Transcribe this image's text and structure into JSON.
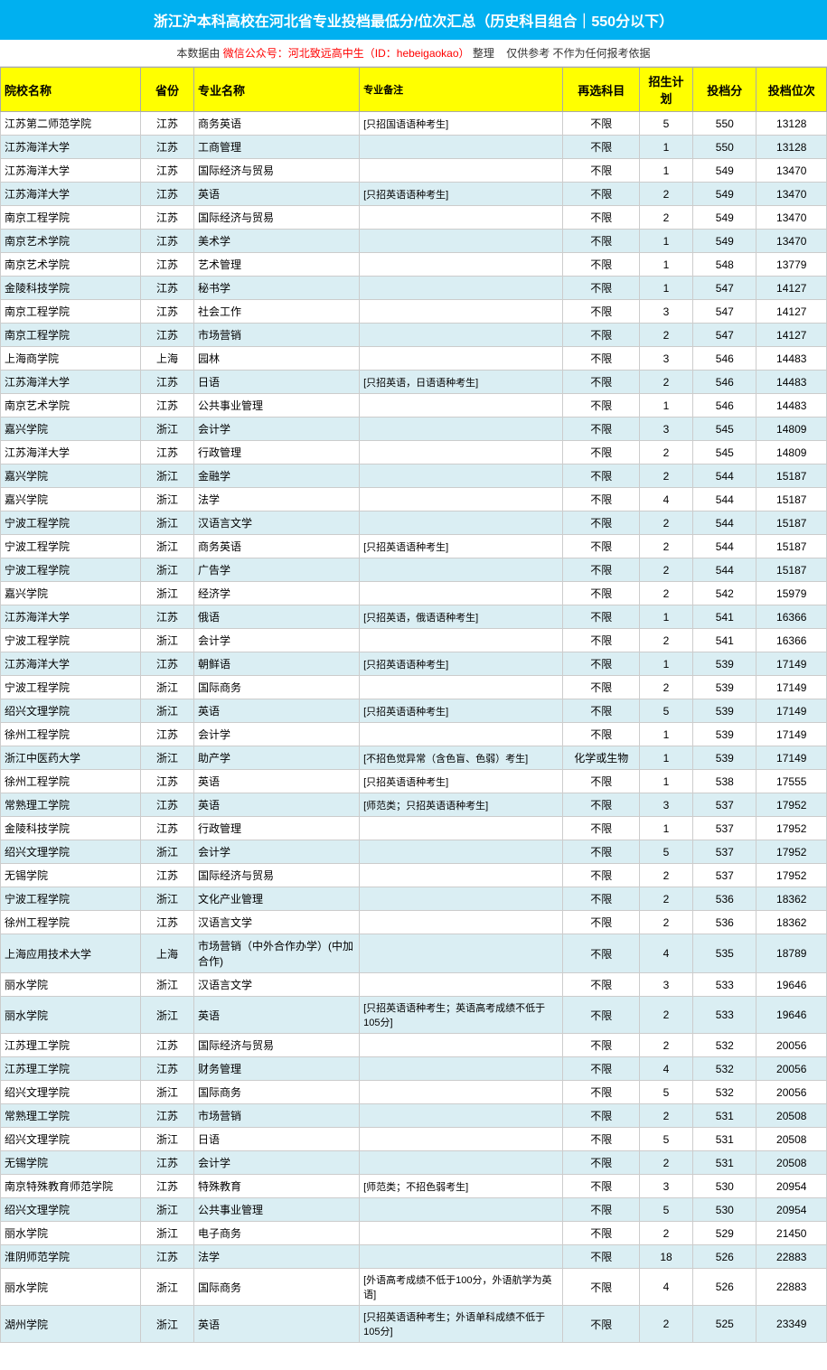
{
  "title": "浙江沪本科高校在河北省专业投档最低分/位次汇总（历史科目组合｜550分以下）",
  "subtitle": {
    "prefix": "本数据由",
    "link": "微信公众号：河北致远高中生（ID：hebeigaokao）",
    "suffix": "整理",
    "note": "仅供参考  不作为任何报考依据"
  },
  "headers": [
    "院校名称",
    "省份",
    "专业名称",
    "专业备注",
    "再选科目",
    "招生计划",
    "投档分",
    "投档位次"
  ],
  "rows": [
    [
      "江苏第二师范学院",
      "江苏",
      "商务英语",
      "[只招国语语种考生]",
      "不限",
      "5",
      "550",
      "13128"
    ],
    [
      "江苏海洋大学",
      "江苏",
      "工商管理",
      "",
      "不限",
      "1",
      "550",
      "13128"
    ],
    [
      "江苏海洋大学",
      "江苏",
      "国际经济与贸易",
      "",
      "不限",
      "1",
      "549",
      "13470"
    ],
    [
      "江苏海洋大学",
      "江苏",
      "英语",
      "[只招英语语种考生]",
      "不限",
      "2",
      "549",
      "13470"
    ],
    [
      "南京工程学院",
      "江苏",
      "国际经济与贸易",
      "",
      "不限",
      "2",
      "549",
      "13470"
    ],
    [
      "南京艺术学院",
      "江苏",
      "美术学",
      "",
      "不限",
      "1",
      "549",
      "13470"
    ],
    [
      "南京艺术学院",
      "江苏",
      "艺术管理",
      "",
      "不限",
      "1",
      "548",
      "13779"
    ],
    [
      "金陵科技学院",
      "江苏",
      "秘书学",
      "",
      "不限",
      "1",
      "547",
      "14127"
    ],
    [
      "南京工程学院",
      "江苏",
      "社会工作",
      "",
      "不限",
      "3",
      "547",
      "14127"
    ],
    [
      "南京工程学院",
      "江苏",
      "市场营销",
      "",
      "不限",
      "2",
      "547",
      "14127"
    ],
    [
      "上海商学院",
      "上海",
      "园林",
      "",
      "不限",
      "3",
      "546",
      "14483"
    ],
    [
      "江苏海洋大学",
      "江苏",
      "日语",
      "[只招英语，日语语种考生]",
      "不限",
      "2",
      "546",
      "14483"
    ],
    [
      "南京艺术学院",
      "江苏",
      "公共事业管理",
      "",
      "不限",
      "1",
      "546",
      "14483"
    ],
    [
      "嘉兴学院",
      "浙江",
      "会计学",
      "",
      "不限",
      "3",
      "545",
      "14809"
    ],
    [
      "江苏海洋大学",
      "江苏",
      "行政管理",
      "",
      "不限",
      "2",
      "545",
      "14809"
    ],
    [
      "嘉兴学院",
      "浙江",
      "金融学",
      "",
      "不限",
      "2",
      "544",
      "15187"
    ],
    [
      "嘉兴学院",
      "浙江",
      "法学",
      "",
      "不限",
      "4",
      "544",
      "15187"
    ],
    [
      "宁波工程学院",
      "浙江",
      "汉语言文学",
      "",
      "不限",
      "2",
      "544",
      "15187"
    ],
    [
      "宁波工程学院",
      "浙江",
      "商务英语",
      "[只招英语语种考生]",
      "不限",
      "2",
      "544",
      "15187"
    ],
    [
      "宁波工程学院",
      "浙江",
      "广告学",
      "",
      "不限",
      "2",
      "544",
      "15187"
    ],
    [
      "嘉兴学院",
      "浙江",
      "经济学",
      "",
      "不限",
      "2",
      "542",
      "15979"
    ],
    [
      "江苏海洋大学",
      "江苏",
      "俄语",
      "[只招英语，俄语语种考生]",
      "不限",
      "1",
      "541",
      "16366"
    ],
    [
      "宁波工程学院",
      "浙江",
      "会计学",
      "",
      "不限",
      "2",
      "541",
      "16366"
    ],
    [
      "江苏海洋大学",
      "江苏",
      "朝鲜语",
      "[只招英语语种考生]",
      "不限",
      "1",
      "539",
      "17149"
    ],
    [
      "宁波工程学院",
      "浙江",
      "国际商务",
      "",
      "不限",
      "2",
      "539",
      "17149"
    ],
    [
      "绍兴文理学院",
      "浙江",
      "英语",
      "[只招英语语种考生]",
      "不限",
      "5",
      "539",
      "17149"
    ],
    [
      "徐州工程学院",
      "江苏",
      "会计学",
      "",
      "不限",
      "1",
      "539",
      "17149"
    ],
    [
      "浙江中医药大学",
      "浙江",
      "助产学",
      "[不招色觉异常（含色盲、色弱）考生]",
      "化学或生物",
      "1",
      "539",
      "17149"
    ],
    [
      "徐州工程学院",
      "江苏",
      "英语",
      "[只招英语语种考生]",
      "不限",
      "1",
      "538",
      "17555"
    ],
    [
      "常熟理工学院",
      "江苏",
      "英语",
      "[师范类；只招英语语种考生]",
      "不限",
      "3",
      "537",
      "17952"
    ],
    [
      "金陵科技学院",
      "江苏",
      "行政管理",
      "",
      "不限",
      "1",
      "537",
      "17952"
    ],
    [
      "绍兴文理学院",
      "浙江",
      "会计学",
      "",
      "不限",
      "5",
      "537",
      "17952"
    ],
    [
      "无锡学院",
      "江苏",
      "国际经济与贸易",
      "",
      "不限",
      "2",
      "537",
      "17952"
    ],
    [
      "宁波工程学院",
      "浙江",
      "文化产业管理",
      "",
      "不限",
      "2",
      "536",
      "18362"
    ],
    [
      "徐州工程学院",
      "江苏",
      "汉语言文学",
      "",
      "不限",
      "2",
      "536",
      "18362"
    ],
    [
      "上海应用技术大学",
      "上海",
      "市场营销（中外合作办学）(中加合作)",
      "",
      "不限",
      "4",
      "535",
      "18789"
    ],
    [
      "丽水学院",
      "浙江",
      "汉语言文学",
      "",
      "不限",
      "3",
      "533",
      "19646"
    ],
    [
      "丽水学院",
      "浙江",
      "英语",
      "[只招英语语种考生；英语高考成绩不低于105分]",
      "不限",
      "2",
      "533",
      "19646"
    ],
    [
      "江苏理工学院",
      "江苏",
      "国际经济与贸易",
      "",
      "不限",
      "2",
      "532",
      "20056"
    ],
    [
      "江苏理工学院",
      "江苏",
      "财务管理",
      "",
      "不限",
      "4",
      "532",
      "20056"
    ],
    [
      "绍兴文理学院",
      "浙江",
      "国际商务",
      "",
      "不限",
      "5",
      "532",
      "20056"
    ],
    [
      "常熟理工学院",
      "江苏",
      "市场营销",
      "",
      "不限",
      "2",
      "531",
      "20508"
    ],
    [
      "绍兴文理学院",
      "浙江",
      "日语",
      "",
      "不限",
      "5",
      "531",
      "20508"
    ],
    [
      "无锡学院",
      "江苏",
      "会计学",
      "",
      "不限",
      "2",
      "531",
      "20508"
    ],
    [
      "南京特殊教育师范学院",
      "江苏",
      "特殊教育",
      "[师范类；不招色弱考生]",
      "不限",
      "3",
      "530",
      "20954"
    ],
    [
      "绍兴文理学院",
      "浙江",
      "公共事业管理",
      "",
      "不限",
      "5",
      "530",
      "20954"
    ],
    [
      "丽水学院",
      "浙江",
      "电子商务",
      "",
      "不限",
      "2",
      "529",
      "21450"
    ],
    [
      "淮阴师范学院",
      "江苏",
      "法学",
      "",
      "不限",
      "18",
      "526",
      "22883"
    ],
    [
      "丽水学院",
      "浙江",
      "国际商务",
      "[外语高考成绩不低于100分，外语航学为英语]",
      "不限",
      "4",
      "526",
      "22883"
    ],
    [
      "湖州学院",
      "浙江",
      "英语",
      "[只招英语语种考生；外语单科成绩不低于105分]",
      "不限",
      "2",
      "525",
      "23349"
    ]
  ]
}
